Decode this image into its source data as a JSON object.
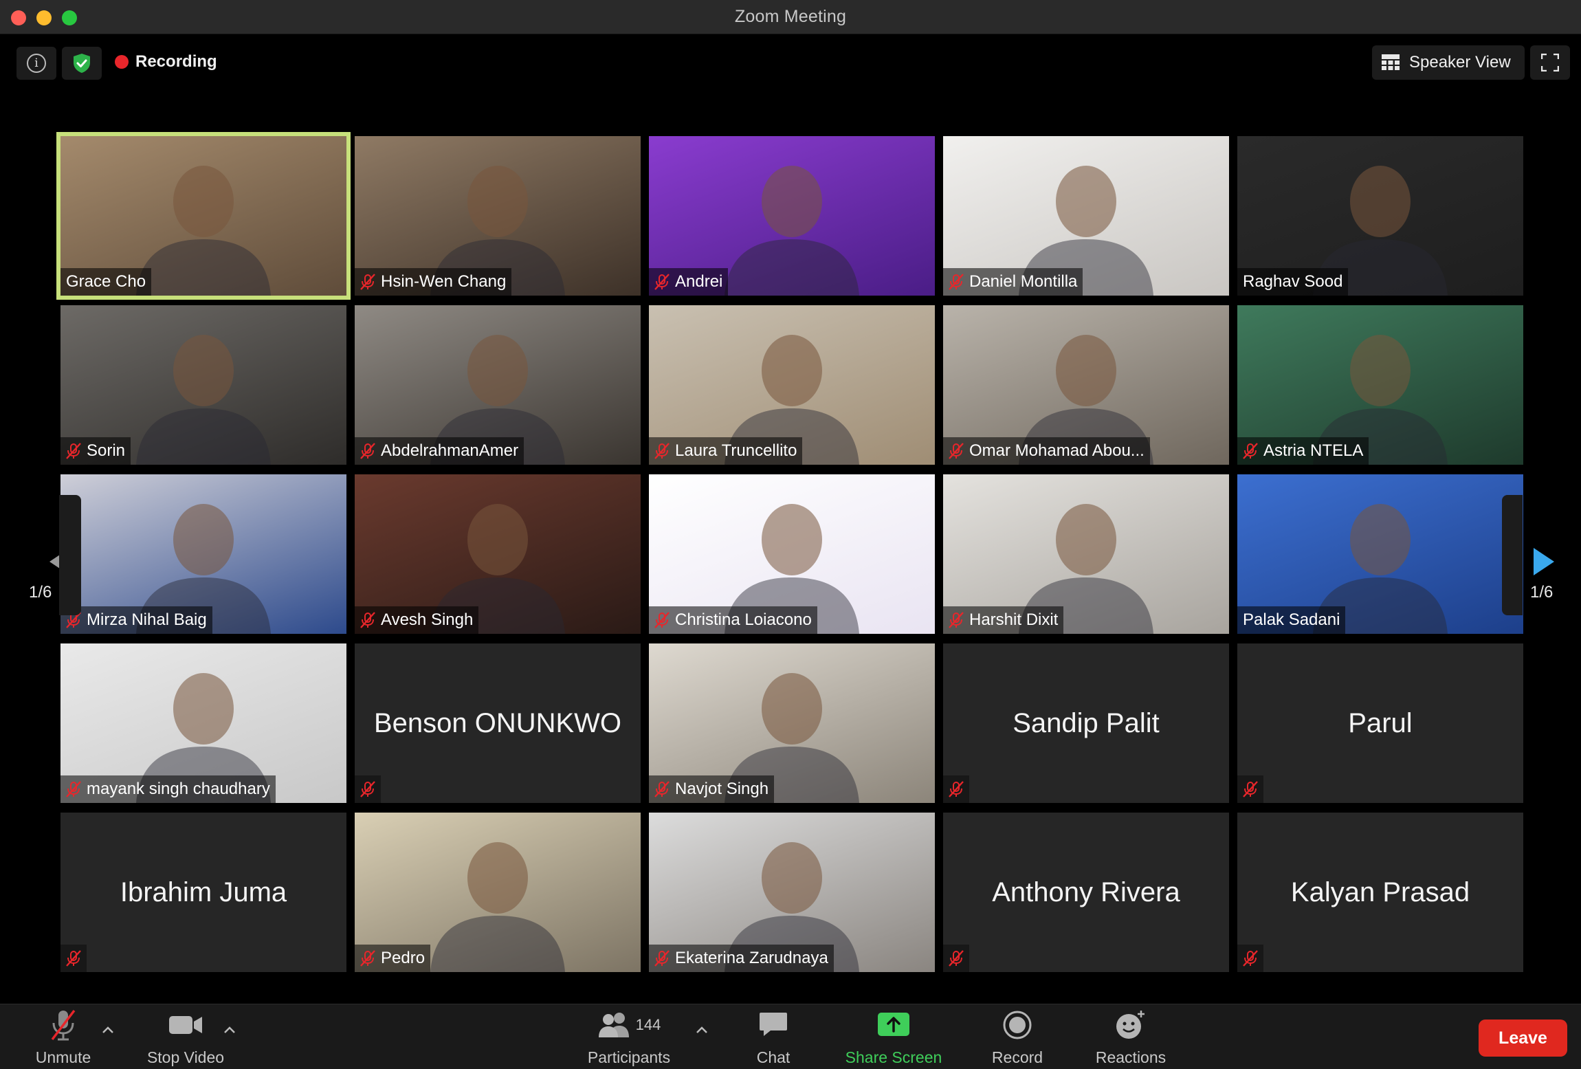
{
  "window": {
    "title": "Zoom Meeting"
  },
  "topbar": {
    "recording_label": "Recording",
    "speaker_view_label": "Speaker View"
  },
  "pagination": {
    "left": "1/6",
    "right": "1/6"
  },
  "participants": [
    {
      "name": "Grace Cho",
      "muted": false,
      "video": true,
      "active": true,
      "bg": [
        "#a48a6c",
        "#5f4c3a"
      ]
    },
    {
      "name": "Hsin-Wen Chang",
      "muted": true,
      "video": true,
      "bg": [
        "#8f7a64",
        "#3d3128"
      ]
    },
    {
      "name": "Andrei",
      "muted": true,
      "video": true,
      "bg": [
        "#8a3ccf",
        "#4a1d86"
      ]
    },
    {
      "name": "Daniel Montilla",
      "muted": true,
      "video": true,
      "bg": [
        "#f1f0ee",
        "#c9c6c2"
      ]
    },
    {
      "name": "Raghav Sood",
      "muted": false,
      "video": true,
      "bg": [
        "#2a2a2a",
        "#1e1e1e"
      ]
    },
    {
      "name": "Sorin",
      "muted": true,
      "video": true,
      "bg": [
        "#6d6a66",
        "#2e2c2a"
      ]
    },
    {
      "name": "AbdelrahmanAmer",
      "muted": true,
      "video": true,
      "bg": [
        "#8f8a84",
        "#3a3530"
      ]
    },
    {
      "name": "Laura Truncellito",
      "muted": true,
      "video": true,
      "bg": [
        "#c9c0b1",
        "#9f8d74"
      ]
    },
    {
      "name": "Omar Mohamad Abou...",
      "muted": true,
      "video": true,
      "bg": [
        "#b9b3aa",
        "#6f675d"
      ]
    },
    {
      "name": "Astria NTELA",
      "muted": true,
      "video": true,
      "bg": [
        "#3f7a5c",
        "#1e3a2c"
      ]
    },
    {
      "name": "Mirza Nihal Baig",
      "muted": true,
      "video": true,
      "bg": [
        "#cfcfd8",
        "#2d4a8c"
      ]
    },
    {
      "name": "Avesh Singh",
      "muted": true,
      "video": true,
      "bg": [
        "#6a3a2e",
        "#2a1a16"
      ]
    },
    {
      "name": "Christina Loiacono",
      "muted": true,
      "video": true,
      "bg": [
        "#ffffff",
        "#e9e4f2"
      ]
    },
    {
      "name": "Harshit Dixit",
      "muted": true,
      "video": true,
      "bg": [
        "#e4e2de",
        "#a8a49e"
      ]
    },
    {
      "name": "Palak Sadani",
      "muted": false,
      "video": true,
      "bg": [
        "#3c6fd0",
        "#1d3f8a"
      ]
    },
    {
      "name": "mayank singh chaudhary",
      "muted": true,
      "video": true,
      "bg": [
        "#e9e9e9",
        "#c8c8c8"
      ]
    },
    {
      "name": "Benson ONUNKWO",
      "muted": true,
      "video": false
    },
    {
      "name": "Navjot Singh",
      "muted": true,
      "video": true,
      "bg": [
        "#ded9d0",
        "#8c857a"
      ]
    },
    {
      "name": "Sandip Palit",
      "muted": true,
      "video": false
    },
    {
      "name": "Parul",
      "muted": true,
      "video": false
    },
    {
      "name": "Ibrahim Juma",
      "muted": true,
      "video": false
    },
    {
      "name": "Pedro",
      "muted": true,
      "video": true,
      "bg": [
        "#d9cfb4",
        "#7d7464"
      ]
    },
    {
      "name": "Ekaterina Zarudnaya",
      "muted": true,
      "video": true,
      "bg": [
        "#dcdcdc",
        "#8a8580"
      ]
    },
    {
      "name": "Anthony Rivera",
      "muted": true,
      "video": false
    },
    {
      "name": "Kalyan Prasad",
      "muted": true,
      "video": false
    }
  ],
  "toolbar": {
    "unmute_label": "Unmute",
    "stop_video_label": "Stop Video",
    "participants_label": "Participants",
    "participants_count": "144",
    "chat_label": "Chat",
    "share_screen_label": "Share Screen",
    "record_label": "Record",
    "reactions_label": "Reactions",
    "leave_label": "Leave"
  },
  "colors": {
    "active_speaker_outline": "#c7e07b",
    "share_green": "#3fce5a",
    "leave_red": "#e0281f",
    "mute_red": "#e8262b",
    "arrow_blue": "#3aa9ee"
  }
}
